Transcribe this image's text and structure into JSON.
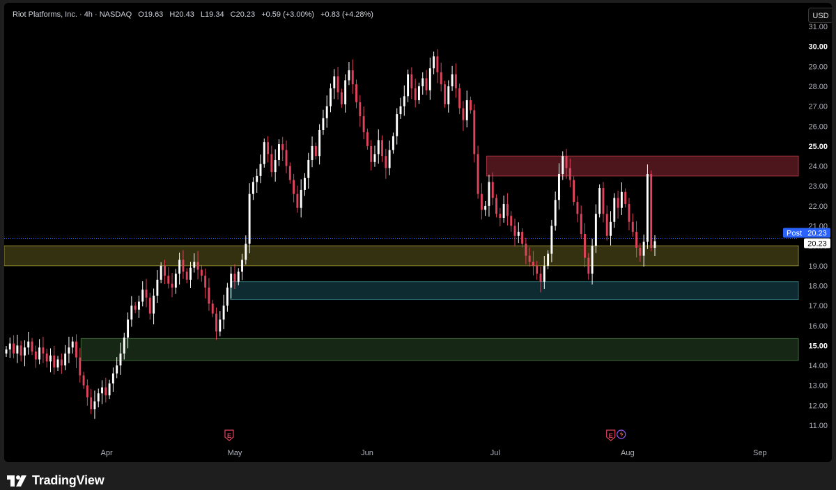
{
  "legend": {
    "symbol": "Riot Platforms, Inc. · 4h · NASDAQ",
    "open": "O19.63",
    "high": "H20.43",
    "low": "L19.34",
    "close": "C20.23",
    "change": "+0.59 (+3.00%)",
    "post_change": "+0.83 (+4.28%)"
  },
  "currency_button": "USD",
  "footer": {
    "logo_text": "TradingView"
  },
  "price_labels": {
    "post_tag": "Post",
    "post_value": "20.23",
    "last_value": "20.23"
  },
  "earnings_marker": "E",
  "colors": {
    "up": "#ffffff",
    "down": "#e0435b",
    "resistance_zone": "#5a1a22",
    "support_zone_yellow": "#3d3a14",
    "support_zone_teal": "#0f3338",
    "support_zone_green": "#1b2e1a",
    "post_line": "#2962ff"
  },
  "chart_data": {
    "type": "candlestick",
    "y_axis": {
      "ylim": [
        10.5,
        31.2
      ],
      "ticks": [
        "31.00",
        "30.00",
        "29.00",
        "28.00",
        "27.00",
        "26.00",
        "25.00",
        "24.00",
        "23.00",
        "22.00",
        "21.00",
        "20.00",
        "19.00",
        "18.00",
        "17.00",
        "16.00",
        "15.00",
        "14.00",
        "13.00",
        "12.00",
        "11.00"
      ],
      "bold_ticks": [
        "30.00",
        "25.00",
        "15.00"
      ]
    },
    "x_axis": {
      "labels": [
        "Apr",
        "May",
        "Jun",
        "Jul",
        "Aug",
        "Sep"
      ],
      "dates": [
        "2024-04-01",
        "2024-05-01",
        "2024-06-01",
        "2024-07-01",
        "2024-08-01",
        "2024-09-01"
      ],
      "xlim": [
        "2024-03-08",
        "2024-09-10"
      ]
    },
    "zones": [
      {
        "name": "resistance",
        "top": 24.5,
        "bottom": 23.5,
        "from": "2024-06-29"
      },
      {
        "name": "support-yellow",
        "top": 20.0,
        "bottom": 19.0,
        "from": "2024-03-08"
      },
      {
        "name": "support-teal",
        "top": 18.2,
        "bottom": 17.3,
        "from": "2024-04-30"
      },
      {
        "name": "support-green",
        "top": 15.35,
        "bottom": 14.25,
        "from": "2024-03-26"
      }
    ],
    "last_price": 20.23,
    "earnings_dates": [
      "2024-05-01",
      "2024-07-31"
    ],
    "closes": [
      14.8,
      15.1,
      14.6,
      15.0,
      14.5,
      14.9,
      15.2,
      14.7,
      14.3,
      14.9,
      14.6,
      14.2,
      14.5,
      13.9,
      14.3,
      14.0,
      14.6,
      14.9,
      15.2,
      14.4,
      13.5,
      13.0,
      12.4,
      11.8,
      12.2,
      12.6,
      12.9,
      12.5,
      13.1,
      13.6,
      14.0,
      14.6,
      15.4,
      16.3,
      17.0,
      16.8,
      17.2,
      17.8,
      17.4,
      16.6,
      17.5,
      18.3,
      19.0,
      18.5,
      18.1,
      17.9,
      18.6,
      19.3,
      18.7,
      18.3,
      18.9,
      19.2,
      18.8,
      18.5,
      17.9,
      17.1,
      16.6,
      15.7,
      16.3,
      17.0,
      17.9,
      18.6,
      18.2,
      18.7,
      19.3,
      20.1,
      22.6,
      23.2,
      23.5,
      24.1,
      25.2,
      24.6,
      23.7,
      24.3,
      25.1,
      24.8,
      24.0,
      23.3,
      22.6,
      21.9,
      22.8,
      23.4,
      24.3,
      25.0,
      24.5,
      25.8,
      26.4,
      27.0,
      27.9,
      28.5,
      27.7,
      27.1,
      28.3,
      28.8,
      28.1,
      27.2,
      26.5,
      25.7,
      25.0,
      24.2,
      24.6,
      25.3,
      24.5,
      23.9,
      24.8,
      25.5,
      26.6,
      27.0,
      27.5,
      28.6,
      27.9,
      27.3,
      28.0,
      28.4,
      27.8,
      28.9,
      29.5,
      28.7,
      28.1,
      27.1,
      28.0,
      28.6,
      27.9,
      26.9,
      26.3,
      27.3,
      26.8,
      24.6,
      22.6,
      21.8,
      22.0,
      23.2,
      22.4,
      21.6,
      21.4,
      22.1,
      21.5,
      21.0,
      20.5,
      20.7,
      20.1,
      19.5,
      19.2,
      19.0,
      18.6,
      18.2,
      19.0,
      19.6,
      21.0,
      22.3,
      23.6,
      24.5,
      23.9,
      23.3,
      22.2,
      21.6,
      20.6,
      19.4,
      18.6,
      20.0,
      21.6,
      22.9,
      21.6,
      20.5,
      21.2,
      22.4,
      21.9,
      22.7,
      22.1,
      21.2,
      20.7,
      19.9,
      19.5,
      20.2,
      23.6,
      19.9,
      20.23
    ]
  }
}
